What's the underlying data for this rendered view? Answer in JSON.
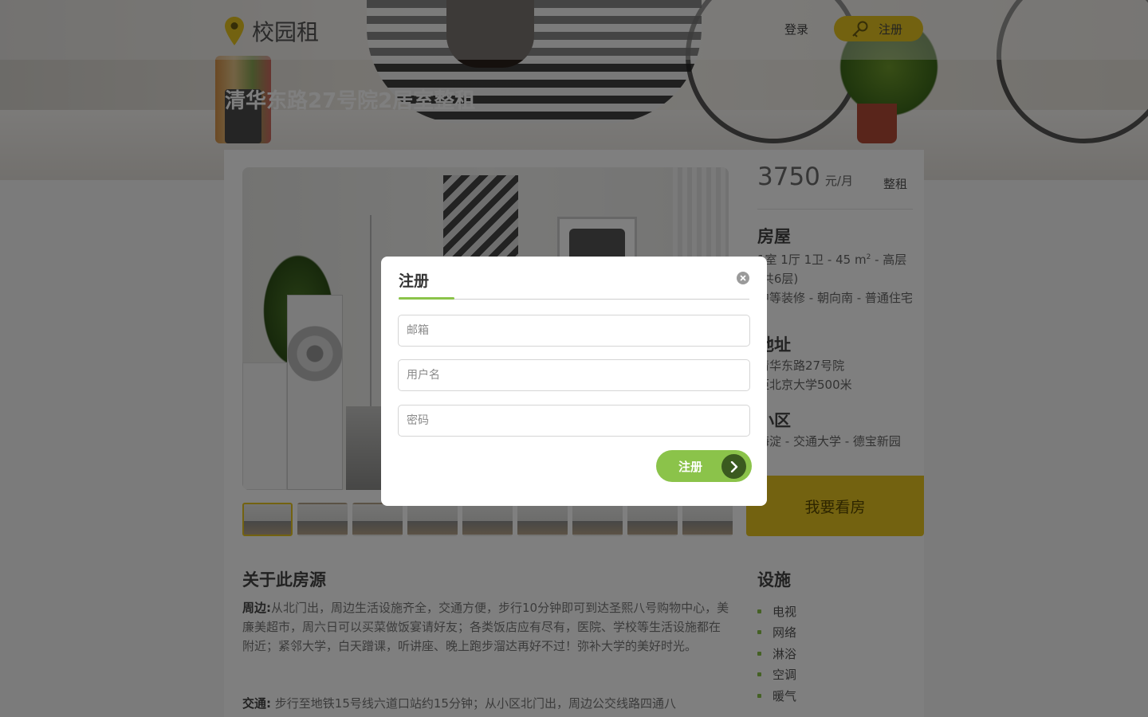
{
  "header": {
    "brand": "校园租",
    "login_label": "登录",
    "register_label": "注册"
  },
  "listing": {
    "title": "清华东路27号院2居室整租",
    "price": "3750",
    "price_unit": "元/月",
    "rent_type": "整租",
    "house": {
      "heading": "房屋",
      "line1_a": "1室 1厅 1卫  - 45 m",
      "line1_sup": "2",
      "line1_b": "  - 高层(共6层)",
      "line2": "中等装修  - 朝向南  - 普通住宅"
    },
    "address": {
      "heading": "地址",
      "line1": "清华东路27号院",
      "line2": "距北京大学500米"
    },
    "community": {
      "heading": "小区",
      "line": "海淀 -  交通大学 -  德宝新园"
    },
    "view_button": "我要看房",
    "about_heading": "关于此房源",
    "surroundings_label": "周边:",
    "surroundings_text": "从北门出，周边生活设施齐全，交通方便，步行10分钟即可到达圣熙八号购物中心，美廉美超市，周六日可以买菜做饭宴请好友；各类饭店应有尽有，医院、学校等生活设施都在附近；紧邻大学，白天蹭课，听讲座、晚上跑步溜达再好不过！弥补大学的美好时光。",
    "transport_label": "交通:",
    "transport_text": "步行至地铁15号线六道口站约15分钟；从小区北门出，周边公交线路四通八",
    "facilities_heading": "设施",
    "facilities": [
      "电视",
      "网络",
      "淋浴",
      "空调",
      "暖气"
    ],
    "thumbnail_count": 9
  },
  "modal": {
    "title": "注册",
    "email_placeholder": "邮箱",
    "username_placeholder": "用户名",
    "password_placeholder": "密码",
    "submit_label": "注册"
  },
  "colors": {
    "accent_yellow": "#e6c520",
    "accent_green": "#8bc34a"
  },
  "icons": [
    "location-pin-icon",
    "key-icon",
    "close-icon",
    "chevron-right-icon"
  ]
}
